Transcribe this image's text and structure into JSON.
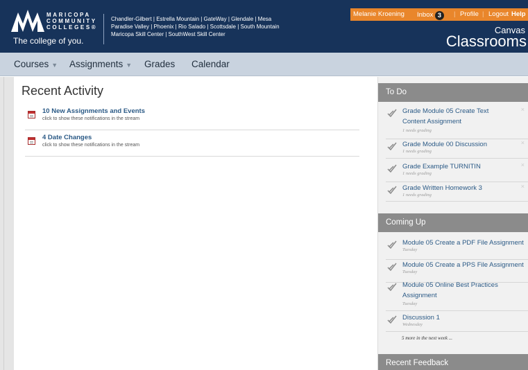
{
  "header": {
    "logo_lines": [
      "MARICOPA",
      "COMMUNITY",
      "COLLEGES®"
    ],
    "tagline": "The college of you.",
    "colleges_lines": [
      "Chandler-Gilbert | Estrella Mountain | GateWay | Glendale | Mesa",
      "Paradise Valley | Phoenix | Rio Salado | Scottsdale | South Mountain",
      "Maricopa Skill Center | SouthWest Skill Center"
    ],
    "user_name": "Melanie Kroening",
    "inbox_label": "Inbox",
    "inbox_count": "3",
    "profile_label": "Profile",
    "logout_label": "Logout",
    "help_label": "Help",
    "separator": "|",
    "product_line1": "Canvas",
    "product_line2": "Classrooms"
  },
  "nav": {
    "courses": "Courses",
    "assignments": "Assignments",
    "grades": "Grades",
    "calendar": "Calendar",
    "caret": "▼"
  },
  "main": {
    "title": "Recent Activity",
    "stream": [
      {
        "title": "10 New Assignments and Events",
        "sub": "click to show these notifications in the stream"
      },
      {
        "title": "4 Date Changes",
        "sub": "click to show these notifications in the stream"
      }
    ]
  },
  "sidebar": {
    "todo_heading": "To Do",
    "todo": [
      {
        "title": "Grade Module 05 Create Text Content Assignment",
        "sub": "1 needs grading"
      },
      {
        "title": "Grade Module 00 Discussion",
        "sub": "1 needs grading"
      },
      {
        "title": "Grade Example TURNITIN",
        "sub": "1 needs grading"
      },
      {
        "title": "Grade Written Homework 3",
        "sub": "1 needs grading"
      }
    ],
    "dismiss": "×",
    "coming_heading": "Coming Up",
    "coming": [
      {
        "title": "Module 05 Create a PDF File Assignment",
        "sub": "Tuesday"
      },
      {
        "title": "Module 05 Create a PPS File Assignment",
        "sub": "Tuesday"
      },
      {
        "title": "Module 05 Online Best Practices Assignment",
        "sub": "Tuesday"
      },
      {
        "title": "Discussion 1",
        "sub": "Wednesday"
      }
    ],
    "more_link": "5 more in the next week ...",
    "feedback_heading": "Recent Feedback"
  },
  "colors": {
    "header_bg": "#17335a",
    "topbar_bg": "#e9862b",
    "nav_bg": "#c9d3df",
    "link": "#2b5a86",
    "sidebar_head": "#8b8b8b"
  }
}
